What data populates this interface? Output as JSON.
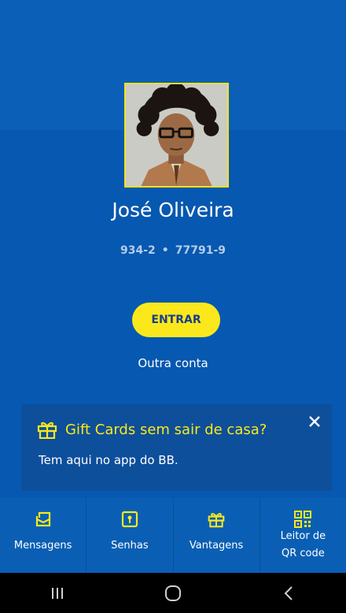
{
  "user": {
    "name": "José Oliveira",
    "agency": "934-2",
    "separator": "•",
    "account": "77791-9"
  },
  "actions": {
    "enter_label": "ENTRAR",
    "other_account_label": "Outra conta"
  },
  "promo": {
    "title": "Gift Cards sem sair de casa?",
    "body": "Tem aqui no app do BB.",
    "icon": "gift-icon",
    "close_icon": "close-icon"
  },
  "bottom_nav": {
    "items": [
      {
        "label": "Mensagens",
        "icon": "message-icon"
      },
      {
        "label": "Senhas",
        "icon": "password-icon"
      },
      {
        "label": "Vantagens",
        "icon": "gift-icon"
      },
      {
        "label_line1": "Leitor de",
        "label_line2": "QR code",
        "icon": "qr-code-icon"
      }
    ]
  },
  "system_nav": {
    "recents": "recents-icon",
    "home": "home-icon",
    "back": "back-icon"
  },
  "colors": {
    "background": "#0a5fb4",
    "accent_yellow": "#fbe81c",
    "promo_background": "#0d4f9b",
    "account_text": "#b5cdea"
  }
}
